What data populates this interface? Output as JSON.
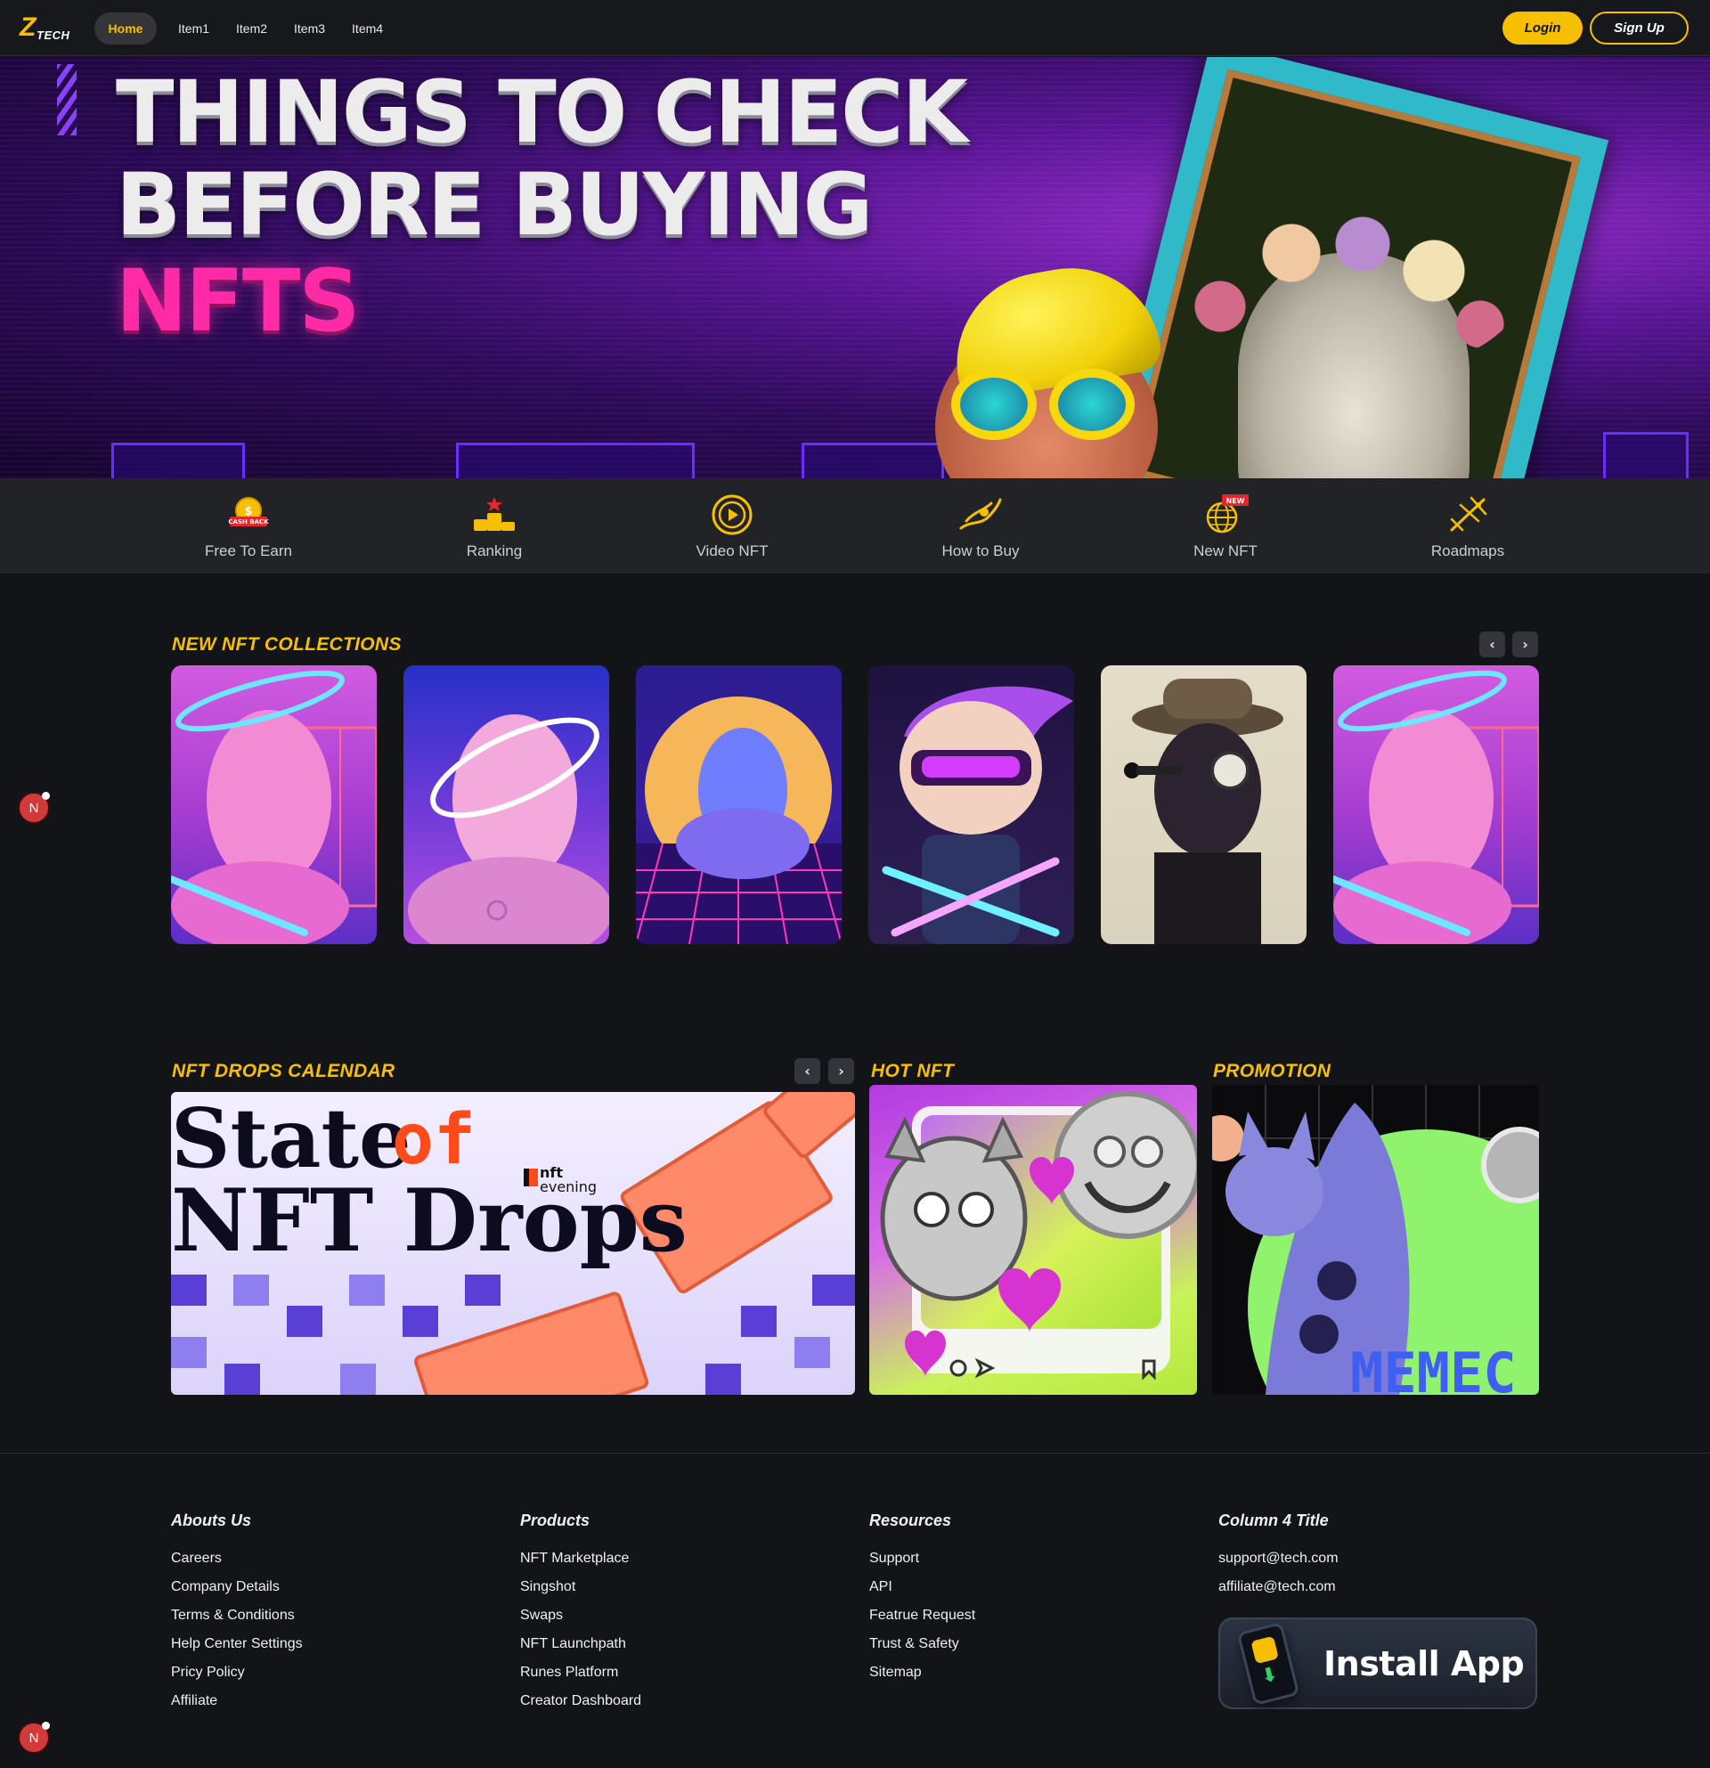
{
  "header": {
    "logo_mark": "Z",
    "logo_text": "TECH",
    "nav": [
      "Home",
      "Item1",
      "Item2",
      "Item3",
      "Item4"
    ],
    "login_label": "Login",
    "signup_label": "Sign Up",
    "accent_color": "#f6c000"
  },
  "hero": {
    "line1": "THINGS TO CHECK",
    "line2": "BEFORE BUYING",
    "line3": "NFTS",
    "accent_color": "#ff2aa6"
  },
  "categories": [
    {
      "label": "Free To Earn",
      "icon": "cashback-coin-icon"
    },
    {
      "label": "Ranking",
      "icon": "podium-icon"
    },
    {
      "label": "Video NFT",
      "icon": "play-circle-icon"
    },
    {
      "label": "How to Buy",
      "icon": "buy-hand-icon"
    },
    {
      "label": "New NFT",
      "icon": "globe-new-icon",
      "badge": "NEW"
    },
    {
      "label": "Roadmaps",
      "icon": "airplane-icon"
    }
  ],
  "cashback_badge": "CASH BACK",
  "collections": {
    "title": "NEW NFT COLLECTIONS",
    "prev_icon": "chevron-left-icon",
    "next_icon": "chevron-right-icon"
  },
  "drops": {
    "title": "NFT DROPS CALENDAR",
    "banner_line1": "State",
    "banner_of": "of",
    "banner_line2": "NFT Drops",
    "brand_top": "nft",
    "brand_bottom": "evening"
  },
  "hot": {
    "title": "HOT NFT"
  },
  "promotion": {
    "title": "PROMOTION",
    "banner_text": "MEMEC"
  },
  "footer": {
    "columns": [
      {
        "title": "Abouts Us",
        "links": [
          "Careers",
          "Company Details",
          "Terms & Conditions",
          "Help Center Settings",
          "Pricy Policy",
          "Affiliate"
        ]
      },
      {
        "title": "Products",
        "links": [
          "NFT Marketplace",
          "Singshot",
          "Swaps",
          "NFT Launchpath",
          "Runes Platform",
          "Creator Dashboard"
        ]
      },
      {
        "title": "Resources",
        "links": [
          "Support",
          "API",
          "Featrue Request",
          "Trust & Safety",
          "Sitemap"
        ]
      },
      {
        "title": "Column 4 Title",
        "links": [
          "support@tech.com",
          "affiliate@tech.com"
        ]
      }
    ],
    "install_label": "Install App"
  },
  "floating_badge": "N"
}
